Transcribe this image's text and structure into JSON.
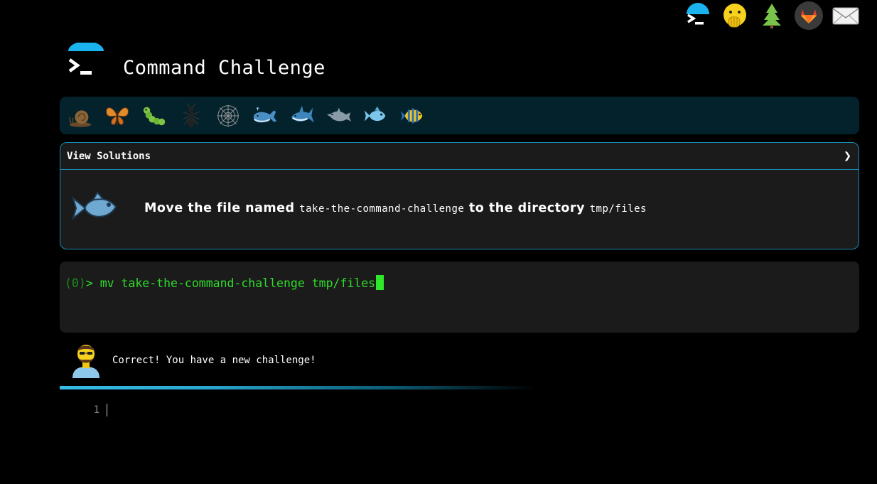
{
  "header": {
    "title": "Command Challenge",
    "top_icons": [
      "terminal-icon",
      "face-with-hand-over-mouth-icon",
      "tree-icon",
      "gitlab-icon",
      "envelope-icon"
    ]
  },
  "levels": [
    "snail-icon",
    "butterfly-icon",
    "caterpillar-icon",
    "ant-icon",
    "spiderweb-icon",
    "whale-icon",
    "shark-icon",
    "dolphin-icon",
    "fish-icon",
    "tropical-fish-icon"
  ],
  "challenge": {
    "solutions_label": "View Solutions",
    "chevron": "❯",
    "task_icon": "fish-icon",
    "text_before": "Move the file named",
    "file_name": "take-the-command-challenge",
    "text_middle": "to the directory",
    "dir_name": "tmp/files"
  },
  "terminal": {
    "status": "(0)",
    "prompt": "> ",
    "command": "mv take-the-command-challenge tmp/files"
  },
  "feedback": {
    "message": "Correct! You have a new challenge!"
  },
  "editor": {
    "line_number": "1"
  },
  "colors": {
    "accent": "#1a8ab3",
    "terminal_text": "#2fdc2a",
    "level_bar": "#04222c",
    "panel": "#1b1b1b"
  }
}
